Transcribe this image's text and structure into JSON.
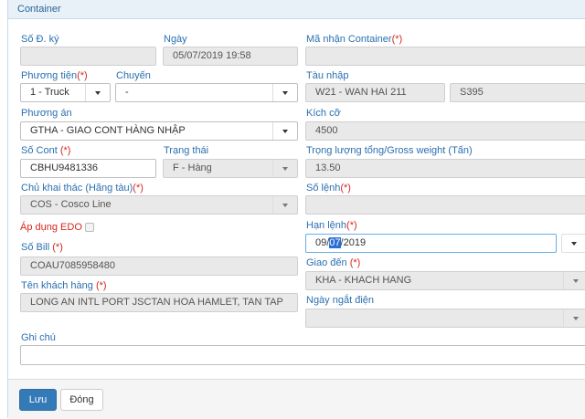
{
  "panel": {
    "title": "Container"
  },
  "fields": {
    "so_dang_ky": {
      "label": "Số Đ. ký",
      "value": ""
    },
    "ngay": {
      "label": "Ngày",
      "value": "05/07/2019 19:58"
    },
    "ma_nhan": {
      "label": "Mã nhận Container",
      "req": "(*)",
      "value": ""
    },
    "phuong_tien": {
      "label": "Phương tiện",
      "req": "(*)",
      "value": "1 - Truck"
    },
    "chuyen": {
      "label": "Chuyến",
      "value": "-"
    },
    "tau_nhap": {
      "label": "Tàu nhập",
      "value": "W21 - WAN HAI 211",
      "value2": "S395"
    },
    "phuong_an": {
      "label": "Phương án",
      "value": "GTHA - GIAO CONT HÀNG NHẬP"
    },
    "kich_co": {
      "label": "Kích cỡ",
      "value": "4500"
    },
    "so_cont": {
      "label": "Số Cont",
      "req": "(*)",
      "value": "CBHU9481336"
    },
    "trang_thai": {
      "label": "Trạng thái",
      "value": "F - Hàng"
    },
    "trong_luong": {
      "label": "Trọng lượng tổng/Gross weight (Tấn)",
      "value": "13.50"
    },
    "chu_khai_thac": {
      "label": "Chủ khai thác (Hãng tàu)",
      "req": "(*)",
      "value": "COS - Cosco Line"
    },
    "so_lenh": {
      "label": "Số lệnh",
      "req": "(*)",
      "value": ""
    },
    "ap_dung_edo": {
      "label": "Áp dụng EDO"
    },
    "han_lenh": {
      "label": "Hạn lệnh",
      "req": "(*)",
      "prefix": "09/",
      "highlight": "07",
      "suffix": "/2019"
    },
    "so_bill": {
      "label": "Số Bill",
      "req": "(*)",
      "value": "COAU7085958480"
    },
    "giao_den": {
      "label": "Giao đến",
      "req": "(*)",
      "value": "KHA - KHACH HANG"
    },
    "ten_khach_hang": {
      "label": "Tên khách hàng",
      "req": "(*)",
      "value": "LONG AN INTL PORT JSCTAN HOA HAMLET, TAN TAP"
    },
    "ngay_ngat_dien": {
      "label": "Ngày ngắt điện",
      "value": ""
    },
    "ghi_chu": {
      "label": "Ghi chú",
      "value": ""
    }
  },
  "buttons": {
    "save": "Lưu",
    "close": "Đóng"
  },
  "colors": {
    "label": "#2a6fb0",
    "required": "#d9261c",
    "primary": "#337ab7",
    "header_bg": "#e8f0f8"
  }
}
